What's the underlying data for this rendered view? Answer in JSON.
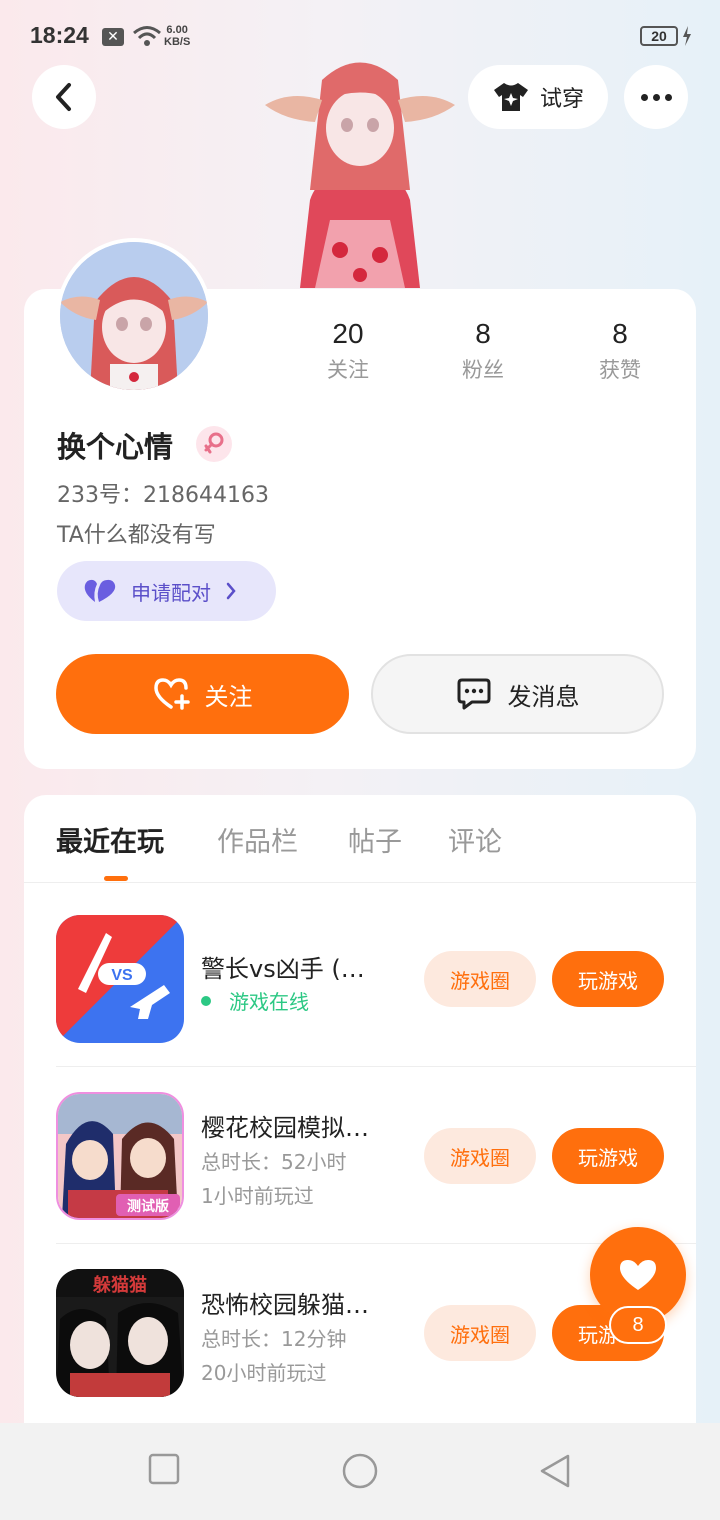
{
  "status_bar": {
    "time": "18:24",
    "net_speed_value": "6.00",
    "net_speed_unit": "KB/S",
    "battery": "20",
    "notification_icon": "x-box-icon",
    "wifi_icon": "wifi-icon"
  },
  "header": {
    "tryon_label": "试穿",
    "back_icon": "chevron-left-icon",
    "more_icon": "more-horizontal-icon"
  },
  "profile": {
    "nickname": "换个心情",
    "gender": "female",
    "user_id": "233号：218644163",
    "bio": "TA什么都没有写",
    "pair_label": "申请配对",
    "stats": [
      {
        "value": "20",
        "label": "关注"
      },
      {
        "value": "8",
        "label": "粉丝"
      },
      {
        "value": "8",
        "label": "获赞"
      }
    ],
    "follow_label": "关注",
    "message_label": "发消息"
  },
  "tabs": [
    {
      "label": "最近在玩",
      "active": true
    },
    {
      "label": "作品栏",
      "active": false
    },
    {
      "label": "帖子",
      "active": false
    },
    {
      "label": "评论",
      "active": false
    }
  ],
  "games": [
    {
      "title": "警长vs凶手 (…",
      "status": "游戏在线",
      "duration": "",
      "last_played": "",
      "circle_label": "游戏圈",
      "play_label": "玩游戏"
    },
    {
      "title": "樱花校园模拟…",
      "status": "",
      "duration": "总时长：52小时",
      "last_played": "1小时前玩过",
      "circle_label": "游戏圈",
      "play_label": "玩游戏"
    },
    {
      "title": "恐怖校园躲猫…",
      "status": "",
      "duration": "总时长：12分钟",
      "last_played": "20小时前玩过",
      "circle_label": "游戏圈",
      "play_label": "玩游戏"
    }
  ],
  "game_icon_text": {
    "vs_badge": "VS",
    "test_badge": "测试版",
    "hide_seek_badge": "躲猫猫"
  },
  "like": {
    "count": "8"
  },
  "colors": {
    "accent": "#ff6f0d",
    "online": "#2cc884",
    "pair": "#5b4fc9"
  }
}
